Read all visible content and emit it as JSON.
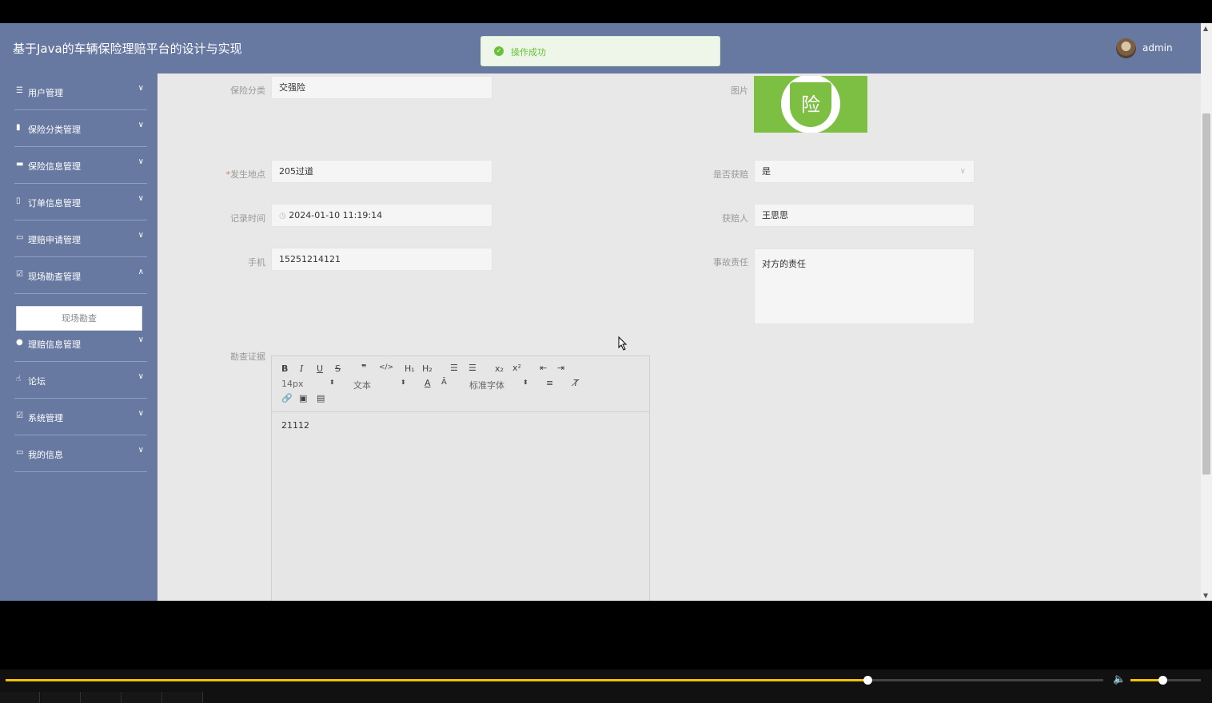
{
  "app": {
    "title": "基于Java的车辆保险理赔平台的设计与实现",
    "username": "admin"
  },
  "toast": {
    "message": "操作成功"
  },
  "sidebar": {
    "items": [
      {
        "label": "用户管理",
        "icon": "list-icon",
        "expanded": false
      },
      {
        "label": "保险分类管理",
        "icon": "book-icon",
        "expanded": false
      },
      {
        "label": "保险信息管理",
        "icon": "briefcase-icon",
        "expanded": false
      },
      {
        "label": "订单信息管理",
        "icon": "clipboard-icon",
        "expanded": false
      },
      {
        "label": "理赔申请管理",
        "icon": "monitor-icon",
        "expanded": false
      },
      {
        "label": "现场勘查管理",
        "icon": "check-clipboard-icon",
        "expanded": true
      },
      {
        "label": "理赔信息管理",
        "icon": "user-icon",
        "expanded": false
      },
      {
        "label": "论坛",
        "icon": "thumbs-up-icon",
        "expanded": false
      },
      {
        "label": "系统管理",
        "icon": "checkbox-icon",
        "expanded": false
      },
      {
        "label": "我的信息",
        "icon": "card-icon",
        "expanded": false
      }
    ],
    "submenu": {
      "label": "现场勘查"
    }
  },
  "form": {
    "category": {
      "label": "保险分类",
      "value": "交强险"
    },
    "image": {
      "label": "图片",
      "badge_char": "险"
    },
    "location": {
      "label": "发生地点",
      "required_mark": "*",
      "value": "205过道"
    },
    "compensated": {
      "label": "是否获赔",
      "value": "是"
    },
    "record_time": {
      "label": "记录时间",
      "value": "2024-01-10 11:19:14"
    },
    "claimant": {
      "label": "获赔人",
      "value": "王思思"
    },
    "phone": {
      "label": "手机",
      "value": "15251214121"
    },
    "liability": {
      "label": "事故责任",
      "value": "对方的责任"
    },
    "evidence": {
      "label": "勘查证据",
      "content": "21112",
      "toolbar": {
        "font_size": "14px",
        "header": "文本",
        "font_family": "标准字体"
      }
    }
  },
  "player": {
    "progress": 0.785,
    "volume": 0.45
  },
  "colors": {
    "header": "#6779a0",
    "accent": "#f2c200",
    "success": "#67c23a"
  }
}
